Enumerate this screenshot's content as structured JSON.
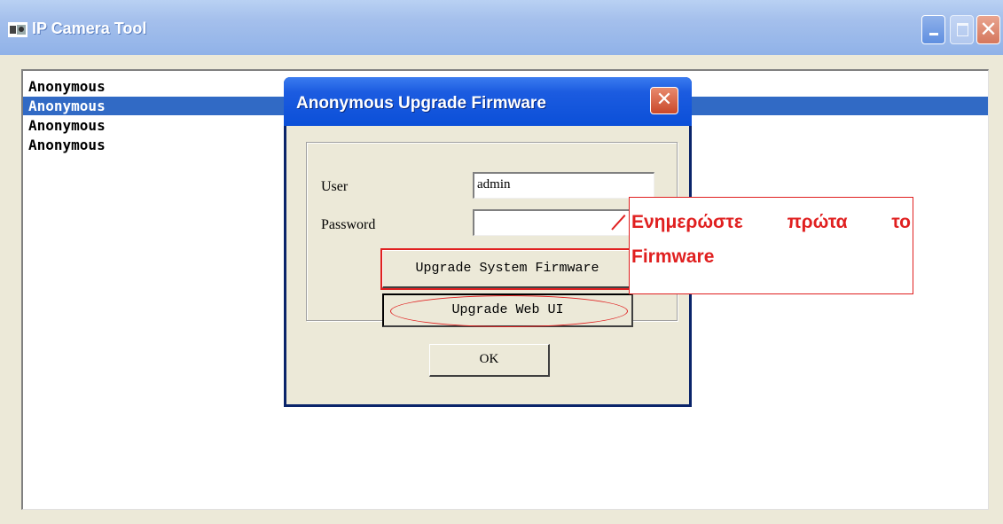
{
  "window": {
    "title": "IP Camera Tool",
    "icon": "camera-app-icon",
    "controls": {
      "minimize": "minimize-icon",
      "maximize": "maximize-icon",
      "close": "✕"
    }
  },
  "device_list": {
    "rows": [
      {
        "label": "Anonymous",
        "selected": false
      },
      {
        "label": "Anonymous",
        "selected": true
      },
      {
        "label": "Anonymous",
        "selected": false
      },
      {
        "label": "Anonymous",
        "selected": false
      }
    ]
  },
  "dialog": {
    "title": "Anonymous Upgrade Firmware",
    "close_label": "✕",
    "user_label": "User",
    "user_value": "admin",
    "password_label": "Password",
    "password_value": "",
    "upgrade_system_label": "Upgrade System Firmware",
    "upgrade_web_label": "Upgrade Web UI",
    "ok_label": "OK"
  },
  "annotation": {
    "text": "Ενημερώστε πρώτα το Firmware",
    "color": "#e02020"
  },
  "colors": {
    "selection": "#316ac5",
    "titlebar": "#0b4fd8",
    "face": "#ece9d8"
  }
}
